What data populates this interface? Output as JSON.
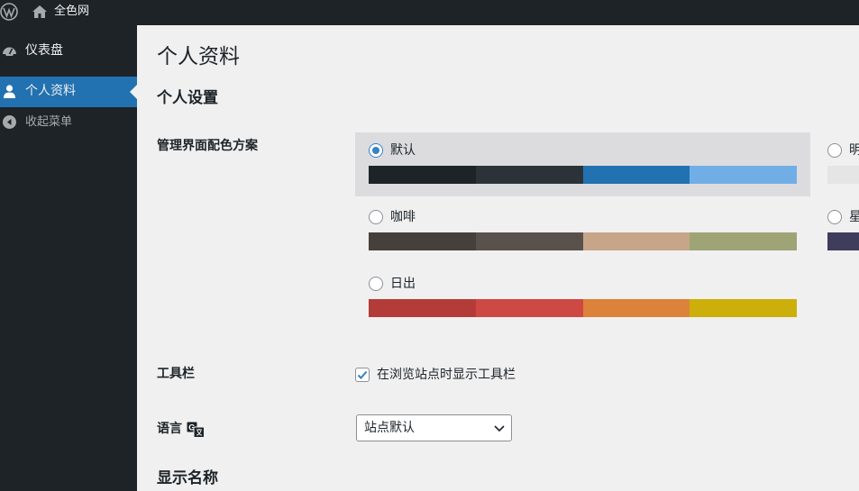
{
  "adminbar": {
    "site_name": "全色网"
  },
  "sidebar": {
    "items": [
      {
        "label": "仪表盘",
        "icon": "dashboard-icon"
      },
      {
        "label": "个人资料",
        "icon": "user-icon",
        "active": true
      },
      {
        "label": "收起菜单",
        "icon": "collapse-icon"
      }
    ]
  },
  "page": {
    "title": "个人资料",
    "personal_settings": "个人设置",
    "color_scheme_label": "管理界面配色方案",
    "toolbar_label": "工具栏",
    "toolbar_checkbox": "在浏览站点时显示工具栏",
    "toolbar_checked": true,
    "language_label": "语言",
    "language_value": "站点默认",
    "display_name": "显示名称"
  },
  "schemes": [
    {
      "name": "默认",
      "selected": true,
      "colors": [
        "#1d2327",
        "#2c3338",
        "#2271b1",
        "#72aee6"
      ]
    },
    {
      "name": "咖啡",
      "selected": false,
      "colors": [
        "#46403c",
        "#59524c",
        "#c7a589",
        "#9ea476"
      ]
    },
    {
      "name": "日出",
      "selected": false,
      "colors": [
        "#b43c38",
        "#cf4944",
        "#dd823b",
        "#ccaf0b"
      ]
    },
    {
      "name": "明",
      "selected": false,
      "colors": [
        "#e5e5e5"
      ]
    },
    {
      "name": "星",
      "selected": false,
      "colors": [
        "#403c5c"
      ]
    }
  ],
  "colors": {
    "accent": "#2271b1",
    "sidebar_bg": "#1d2327",
    "content_bg": "#f0f0f1"
  }
}
